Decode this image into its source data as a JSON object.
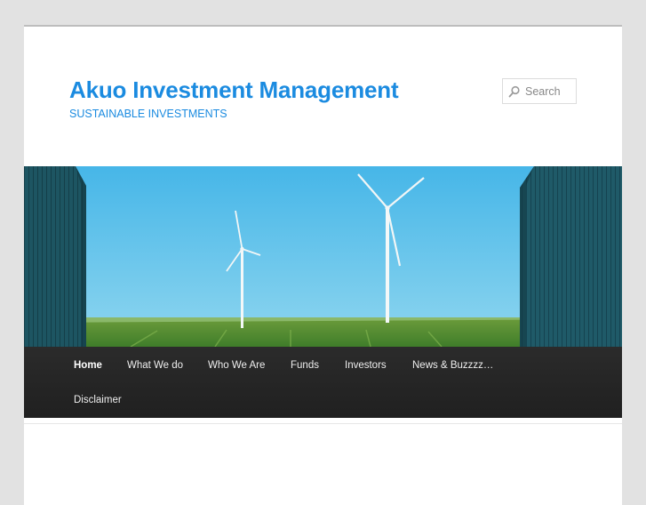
{
  "site": {
    "title": "Akuo Investment Management",
    "tagline": "SUSTAINABLE INVESTMENTS"
  },
  "search": {
    "placeholder": "Search",
    "icon": "search-icon"
  },
  "banner": {
    "subject": "wind-turbines-between-barns",
    "sky_color": "#4bb8e6",
    "field_color": "#4c8a2e",
    "barn_color": "#1c5360"
  },
  "nav": {
    "items": [
      {
        "label": "Home",
        "active": true
      },
      {
        "label": "What We do"
      },
      {
        "label": "Who We Are"
      },
      {
        "label": "Funds"
      },
      {
        "label": "Investors"
      },
      {
        "label": "News & Buzzzz…"
      },
      {
        "label": "Disclaimer"
      }
    ]
  },
  "colors": {
    "accent": "#1b8be0",
    "nav_bg": "#252525",
    "page_bg": "#e2e2e2"
  }
}
